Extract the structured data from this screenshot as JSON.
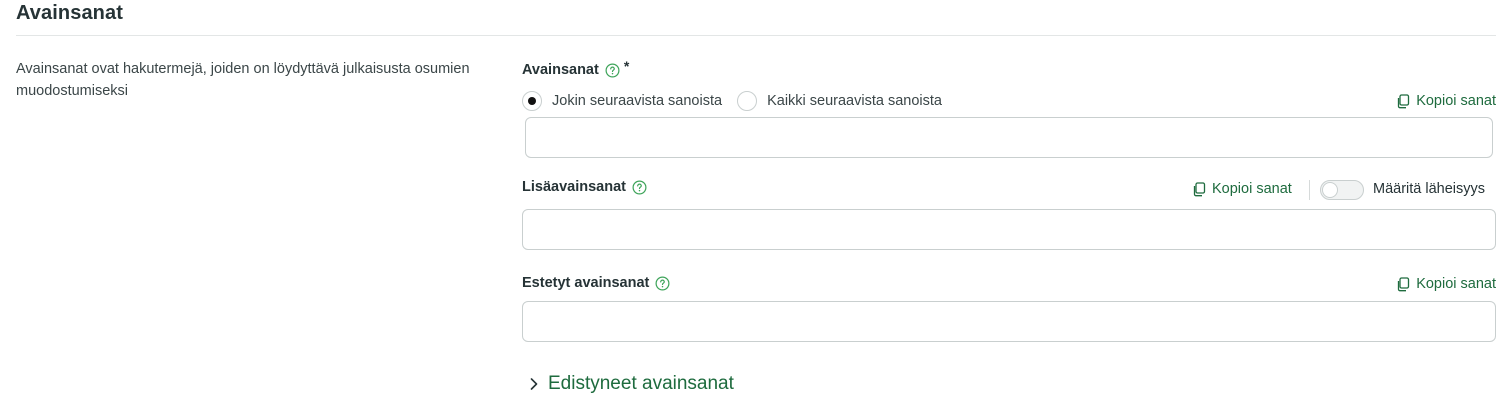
{
  "section": {
    "title": "Avainsanat",
    "description": "Avainsanat ovat hakutermejä, joiden on löydyttävä julkaisusta osumien muodostumiseksi"
  },
  "keywords": {
    "label": "Avainsanat",
    "required_mark": "*",
    "radio_any": "Jokin seuraavista sanoista",
    "radio_all": "Kaikki seuraavista sanoista",
    "selected": "any",
    "copy_label": "Kopioi sanat",
    "value": ""
  },
  "additional_keywords": {
    "label": "Lisäavainsanat",
    "copy_label": "Kopioi sanat",
    "proximity_label": "Määritä läheisyys",
    "proximity_enabled": false,
    "value": ""
  },
  "excluded_keywords": {
    "label": "Estetyt avainsanat",
    "copy_label": "Kopioi sanat",
    "value": ""
  },
  "advanced": {
    "label": "Edistyneet avainsanat",
    "expanded": false
  },
  "colors": {
    "accent": "#1e6b3e",
    "help_icon": "#3ea45a",
    "border": "#c9cfcf",
    "text": "#263336"
  },
  "icons": {
    "help": "help-circle-icon",
    "copy": "copy-icon",
    "expand": "chevron-right-icon"
  }
}
